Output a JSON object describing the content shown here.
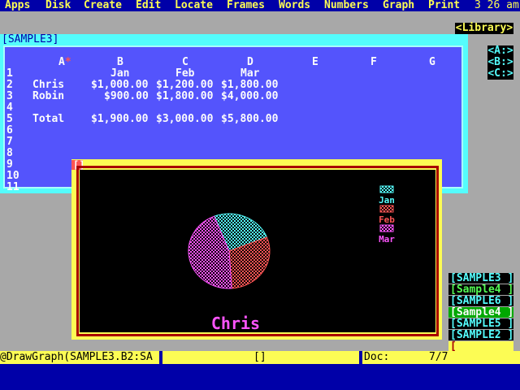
{
  "menu": {
    "items": [
      "Apps",
      "Disk",
      "Create",
      "Edit",
      "Locate",
      "Frames",
      "Words",
      "Numbers",
      "Graph",
      "Print"
    ],
    "clock": "3 26 am"
  },
  "library": "<Library>",
  "drives": [
    "<A:>",
    "<B:>",
    "<C:>"
  ],
  "sheet": {
    "title": "[SAMPLE3]",
    "columns": [
      "A",
      "B",
      "C",
      "D",
      "E",
      "F",
      "G"
    ],
    "rows": [
      "1",
      "2",
      "3",
      "4",
      "5",
      "6",
      "7",
      "8",
      "9",
      "10",
      "11"
    ],
    "headers": [
      "Jan",
      "Feb",
      "Mar"
    ],
    "data": [
      {
        "label": "Chris",
        "values": [
          "$1,000.00",
          "$1,200.00",
          "$1,800.00"
        ]
      },
      {
        "label": "Robin",
        "values": [
          "$900.00",
          "$1,800.00",
          "$4,000.00"
        ]
      },
      {
        "label": "Total",
        "values": [
          "$1,900.00",
          "$3,000.00",
          "$5,800.00"
        ]
      }
    ]
  },
  "chart": {
    "frame_label": "[]",
    "caption": "Chris"
  },
  "chart_data": {
    "type": "pie",
    "title": "Chris",
    "categories": [
      "Jan",
      "Feb",
      "Mar"
    ],
    "values": [
      1000,
      1200,
      1800
    ],
    "colors": [
      "#54fcfc",
      "#fc5454",
      "#fc54fc"
    ],
    "legend": "right"
  },
  "windows": [
    {
      "label": "[SAMPLE3 ]",
      "bg": "#000",
      "fg": "#54fcfc"
    },
    {
      "label": "[Sample4 ]",
      "bg": "#000",
      "fg": "#54fc54"
    },
    {
      "label": "[SAMPLE6 ]",
      "bg": "#000",
      "fg": "#54fcfc"
    },
    {
      "label": "[Sample4 ]",
      "bg": "#00a800",
      "fg": "#fcfcfc"
    },
    {
      "label": "[SAMPLE5 ]",
      "bg": "#000",
      "fg": "#54fcfc"
    },
    {
      "label": "[SAMPLE2 ]",
      "bg": "#000",
      "fg": "#54fcfc"
    },
    {
      "label": "[        ",
      "bg": "#fcfc54",
      "fg": "#a80000"
    }
  ],
  "status": {
    "command": "@DrawGraph(SAMPLE3.B2:SA",
    "frame": "[]",
    "doc_label": "Doc:",
    "doc_pages": "7/7"
  }
}
